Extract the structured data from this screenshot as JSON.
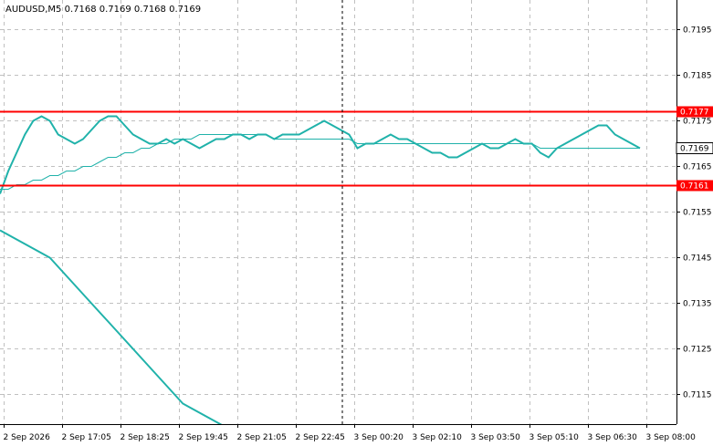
{
  "chart_data": {
    "type": "line",
    "title": "AUDUSD,M5  0.7168 0.7169 0.7168 0.7169",
    "symbol": "AUDUSD",
    "timeframe": "M5",
    "y_ticks": [
      "0.7195",
      "0.7185",
      "0.7175",
      "0.7165",
      "0.7155",
      "0.7145",
      "0.7135",
      "0.7125",
      "0.7115"
    ],
    "y_tick_values": [
      0.7195,
      0.7185,
      0.7175,
      0.7165,
      0.7155,
      0.7145,
      0.7135,
      0.7125,
      0.7115
    ],
    "x_ticks": [
      "2 Sep 2026",
      "2 Sep 17:05",
      "2 Sep 18:25",
      "2 Sep 19:45",
      "2 Sep 21:05",
      "2 Sep 22:45",
      "3 Sep 00:20",
      "3 Sep 02:10",
      "3 Sep 03:50",
      "3 Sep 05:10",
      "3 Sep 06:30",
      "3 Sep 08:00"
    ],
    "ylim": [
      0.71085,
      0.72015
    ],
    "grid": true,
    "colors": {
      "candles": "#000000",
      "bollinger_bands": "#20b2aa",
      "level_lines": "#ff0000",
      "background": "#ffffff"
    },
    "levels": [
      {
        "value": 0.7177,
        "label": "0.7177"
      },
      {
        "value": 0.7161,
        "label": "0.7161"
      }
    ],
    "current_price": {
      "value": 0.7169,
      "label": "0.7169"
    },
    "series": [
      {
        "values": [
          0.7159,
          0.7164,
          0.7168,
          0.7172,
          0.7175,
          0.7176,
          0.7175,
          0.7172,
          0.7171,
          0.717,
          0.7171,
          0.7173,
          0.7175,
          0.7176,
          0.7176,
          0.7174,
          0.7172,
          0.7171,
          0.717,
          0.717,
          0.7171,
          0.717,
          0.7171,
          0.717,
          0.7169,
          0.717,
          0.7171,
          0.7171,
          0.7172,
          0.7172,
          0.7171,
          0.7172,
          0.7172,
          0.7171,
          0.7172,
          0.7172,
          0.7172,
          0.7173,
          0.7174,
          0.7175,
          0.7174,
          0.7173,
          0.7172,
          0.7169,
          0.717,
          0.717,
          0.7171,
          0.7172,
          0.7171,
          0.7171,
          0.717,
          0.7169,
          0.7168,
          0.7168,
          0.7167,
          0.7167,
          0.7168,
          0.7169,
          0.717,
          0.7169,
          0.7169,
          0.717,
          0.7171,
          0.717,
          0.717,
          0.7168,
          0.7167,
          0.7169,
          0.717,
          0.7171,
          0.7172,
          0.7173,
          0.7174,
          0.7174,
          0.7172,
          0.7171,
          0.717,
          0.7169
        ]
      },
      {
        "values": [
          0.716,
          0.716,
          0.7161,
          0.7161,
          0.7162,
          0.7162,
          0.7163,
          0.7163,
          0.7164,
          0.7164,
          0.7165,
          0.7165,
          0.7166,
          0.7167,
          0.7167,
          0.7168,
          0.7168,
          0.7169,
          0.7169,
          0.717,
          0.717,
          0.7171,
          0.7171,
          0.7171,
          0.7172,
          0.7172,
          0.7172,
          0.7172,
          0.7172,
          0.7172,
          0.7172,
          0.7172,
          0.7172,
          0.7171,
          0.7171,
          0.7171,
          0.7171,
          0.7171,
          0.7171,
          0.7171,
          0.7171,
          0.7171,
          0.7171,
          0.717,
          0.717,
          0.717,
          0.717,
          0.717,
          0.717,
          0.717,
          0.717,
          0.717,
          0.717,
          0.717,
          0.717,
          0.717,
          0.717,
          0.717,
          0.717,
          0.717,
          0.717,
          0.717,
          0.717,
          0.717,
          0.717,
          0.7169,
          0.7169,
          0.7169,
          0.7169,
          0.7169,
          0.7169,
          0.7169,
          0.7169,
          0.7169,
          0.7169,
          0.7169,
          0.7169,
          0.7169
        ]
      },
      {
        "values": [
          0.7151,
          0.715,
          0.7149,
          0.7148,
          0.7147,
          0.7146,
          0.7145,
          0.7143,
          0.7141,
          0.7139,
          0.7137,
          0.7135,
          0.7133,
          0.7131,
          0.7129,
          0.7127,
          0.7125,
          0.7123,
          0.7121,
          0.7119,
          0.7117,
          0.7115,
          0.7113,
          0.7112,
          0.7111,
          0.711,
          0.7109,
          0.7108,
          0.7108,
          0.7108,
          0.7108,
          0.7108,
          0.7108,
          0.7108,
          0.7108,
          0.7108,
          0.7108,
          0.7108,
          0.7108,
          0.7108,
          0.7108,
          0.7108,
          0.7108,
          0.7108,
          0.7108,
          0.7108,
          0.7108,
          0.7108,
          0.7108,
          0.7108,
          0.7108,
          0.7108,
          0.7108,
          0.7108,
          0.7108,
          0.7108,
          0.7108,
          0.7108,
          0.7108,
          0.7108,
          0.7108,
          0.7108,
          0.7108,
          0.7108,
          0.7108,
          0.7108,
          0.7108,
          0.7108,
          0.7108,
          0.7108,
          0.7108,
          0.7108,
          0.7108,
          0.7108,
          0.7108,
          0.7108,
          0.7108,
          0.7108
        ]
      }
    ]
  }
}
